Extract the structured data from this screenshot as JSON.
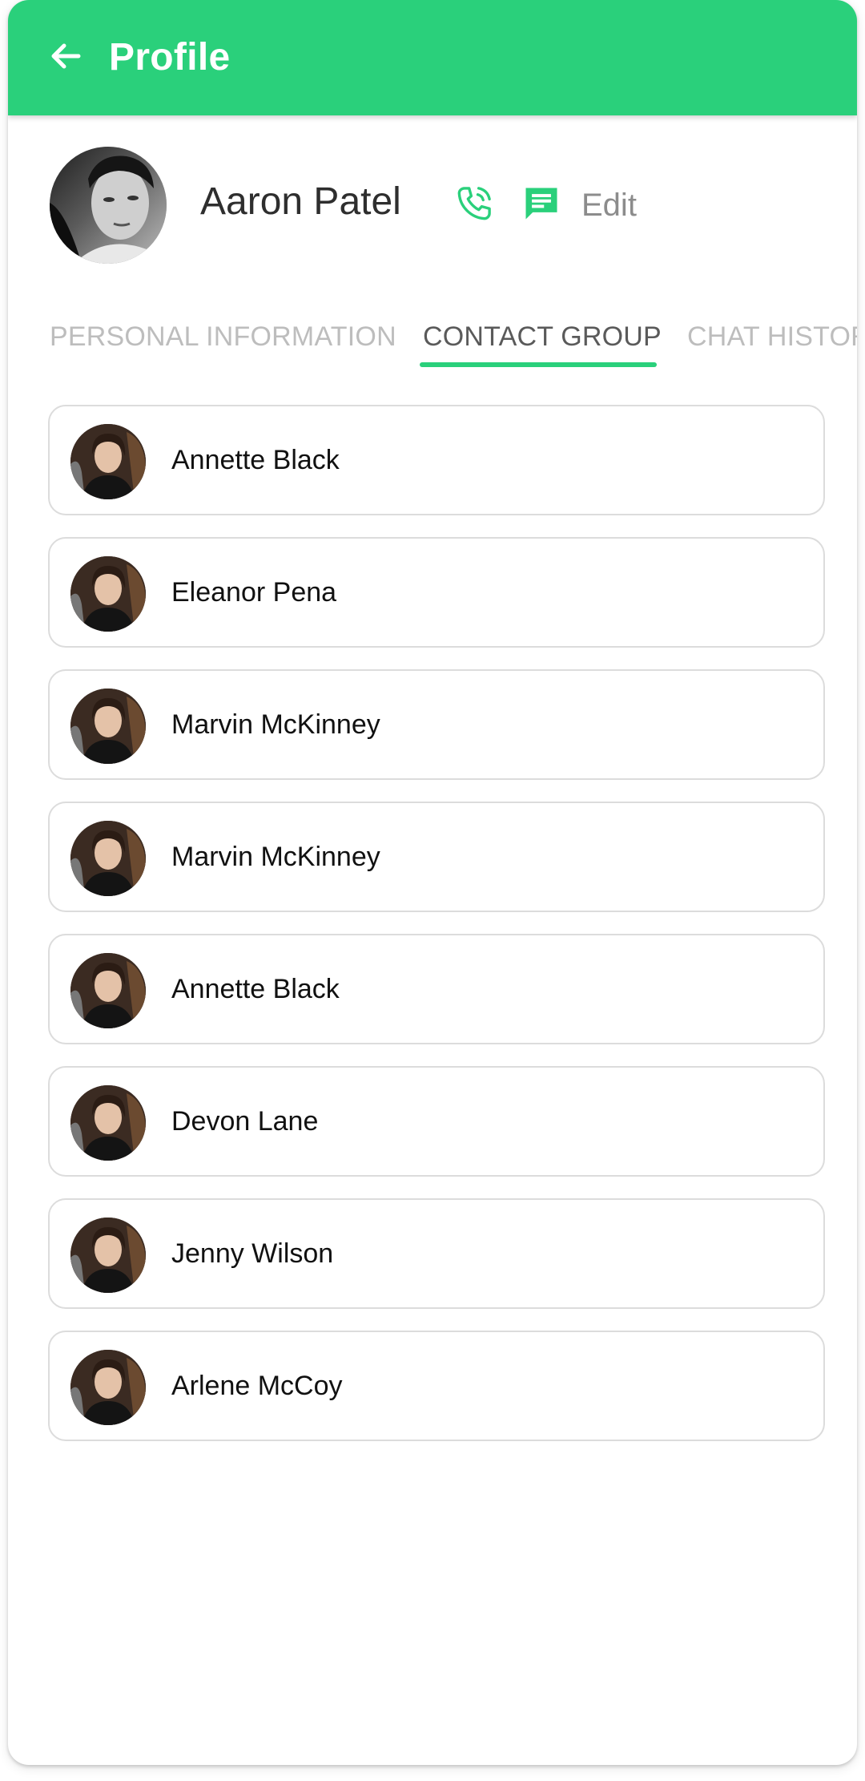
{
  "header": {
    "title": "Profile",
    "back_icon": "arrow-left-icon",
    "background_color": "#2ad07b"
  },
  "profile": {
    "name": "Aaron Patel",
    "call_icon": "phone-icon",
    "message_icon": "message-icon",
    "edit_label": "Edit"
  },
  "tabs": [
    {
      "label": "PERSONAL INFORMATION",
      "active": false
    },
    {
      "label": "CONTACT GROUP",
      "active": true
    },
    {
      "label": "CHAT HISTORY",
      "active": false
    }
  ],
  "contacts": [
    {
      "name": "Annette Black"
    },
    {
      "name": "Eleanor Pena"
    },
    {
      "name": "Marvin McKinney"
    },
    {
      "name": "Marvin McKinney"
    },
    {
      "name": "Annette Black"
    },
    {
      "name": "Devon Lane"
    },
    {
      "name": "Jenny Wilson"
    },
    {
      "name": "Arlene McCoy"
    }
  ],
  "colors": {
    "accent": "#2ad07b",
    "card_border": "#dcdcdc",
    "inactive_tab": "#bdbdbd",
    "active_tab": "#5a5a5a"
  }
}
